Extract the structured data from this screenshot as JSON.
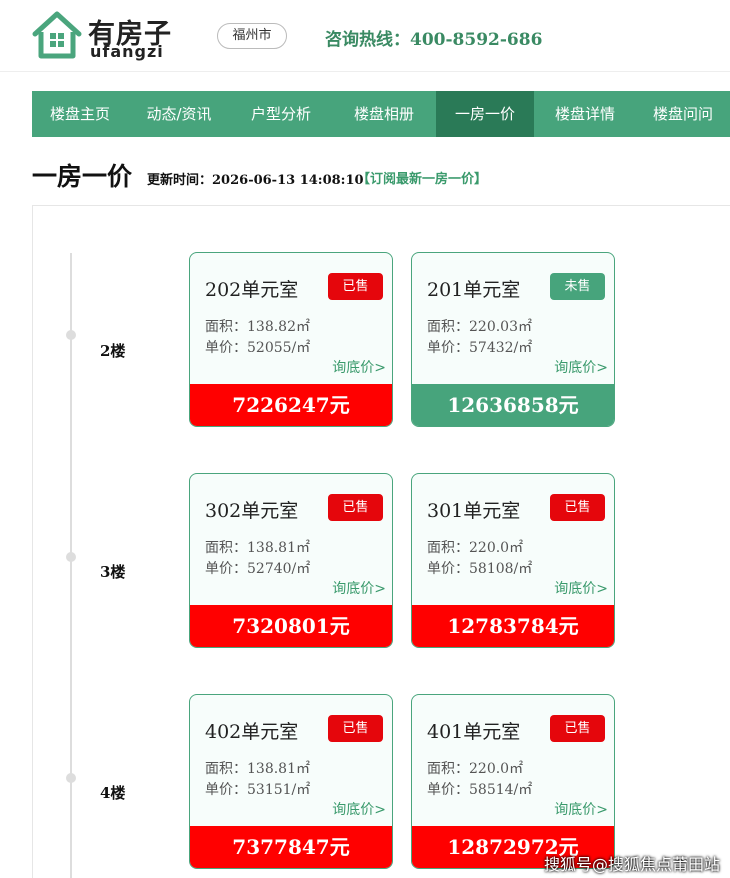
{
  "header": {
    "logo_cn": "有房子",
    "logo_en": "ufangzi",
    "city": "福州市",
    "hotline_label": "咨询热线：",
    "hotline_number": "400-8592-686"
  },
  "nav": {
    "items": [
      "楼盘主页",
      "动态/资讯",
      "户型分析",
      "楼盘相册",
      "一房一价",
      "楼盘详情",
      "楼盘问问"
    ],
    "active_index": 4
  },
  "page": {
    "title": "一房一价",
    "update_label": "更新时间：",
    "update_time": "2026-06-13 14:08:10",
    "subscribe": "【订阅最新一房一价】"
  },
  "floors": [
    {
      "label": "2楼",
      "units": [
        {
          "room": "202单元室",
          "status": "已售",
          "sold": true,
          "area": "面积：138.82㎡",
          "unit_price": "单价：52055/㎡",
          "ask": "询底价>",
          "total": "7226247元"
        },
        {
          "room": "201单元室",
          "status": "未售",
          "sold": false,
          "area": "面积：220.03㎡",
          "unit_price": "单价：57432/㎡",
          "ask": "询底价>",
          "total": "12636858元"
        }
      ]
    },
    {
      "label": "3楼",
      "units": [
        {
          "room": "302单元室",
          "status": "已售",
          "sold": true,
          "area": "面积：138.81㎡",
          "unit_price": "单价：52740/㎡",
          "ask": "询底价>",
          "total": "7320801元"
        },
        {
          "room": "301单元室",
          "status": "已售",
          "sold": true,
          "area": "面积：220.0㎡",
          "unit_price": "单价：58108/㎡",
          "ask": "询底价>",
          "total": "12783784元"
        }
      ]
    },
    {
      "label": "4楼",
      "units": [
        {
          "room": "402单元室",
          "status": "已售",
          "sold": true,
          "area": "面积：138.81㎡",
          "unit_price": "单价：53151/㎡",
          "ask": "询底价>",
          "total": "7377847元"
        },
        {
          "room": "401单元室",
          "status": "已售",
          "sold": true,
          "area": "面积：220.0㎡",
          "unit_price": "单价：58514/㎡",
          "ask": "询底价>",
          "total": "12872972元"
        }
      ]
    }
  ],
  "watermark": "搜狐号@搜狐焦点莆田站",
  "colors": {
    "brand_green": "#47a47c",
    "nav_active": "#2a7a57",
    "sold_red": "#ff0000"
  },
  "icons": {
    "logo": "house-icon"
  }
}
